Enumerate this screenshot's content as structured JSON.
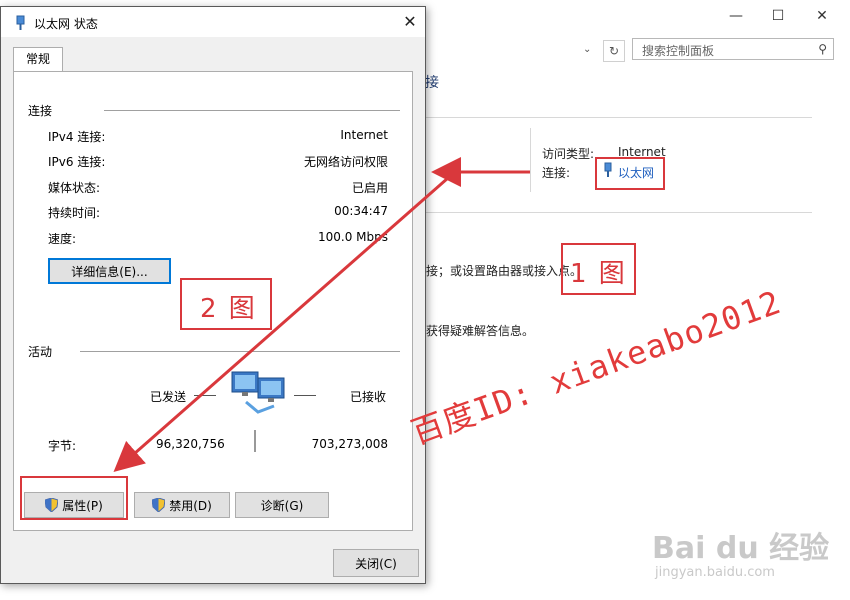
{
  "background": {
    "search_placeholder": "搜索控制面板",
    "heading_fragment": "接",
    "access_type_label": "访问类型:",
    "access_type_value": "Internet",
    "connection_label": "连接:",
    "connection_link": "以太网",
    "line1_fragment": "接；或设置路由器或接入点。",
    "line2_fragment": "获得疑难解答信息。"
  },
  "dialog": {
    "title": "以太网 状态",
    "tab_label": "常规",
    "connection_group": "连接",
    "rows": [
      {
        "label": "IPv4 连接:",
        "value": "Internet"
      },
      {
        "label": "IPv6 连接:",
        "value": "无网络访问权限"
      },
      {
        "label": "媒体状态:",
        "value": "已启用"
      },
      {
        "label": "持续时间:",
        "value": "00:34:47"
      },
      {
        "label": "速度:",
        "value": "100.0 Mbps"
      }
    ],
    "details_button": "详细信息(E)...",
    "activity_group": "活动",
    "sent_label": "已发送",
    "received_label": "已接收",
    "bytes_label": "字节:",
    "bytes_sent": "96,320,756",
    "bytes_received": "703,273,008",
    "properties_button": "属性(P)",
    "disable_button": "禁用(D)",
    "diagnose_button": "诊断(G)",
    "close_button": "关闭(C)"
  },
  "annotations": {
    "label1": "1 图",
    "label2": "2 图",
    "watermark": "百度ID: xiakeabo2012",
    "baidu_logo": "Bai du 经验",
    "baidu_url": "jingyan.baidu.com",
    "color": "#d9383c"
  }
}
